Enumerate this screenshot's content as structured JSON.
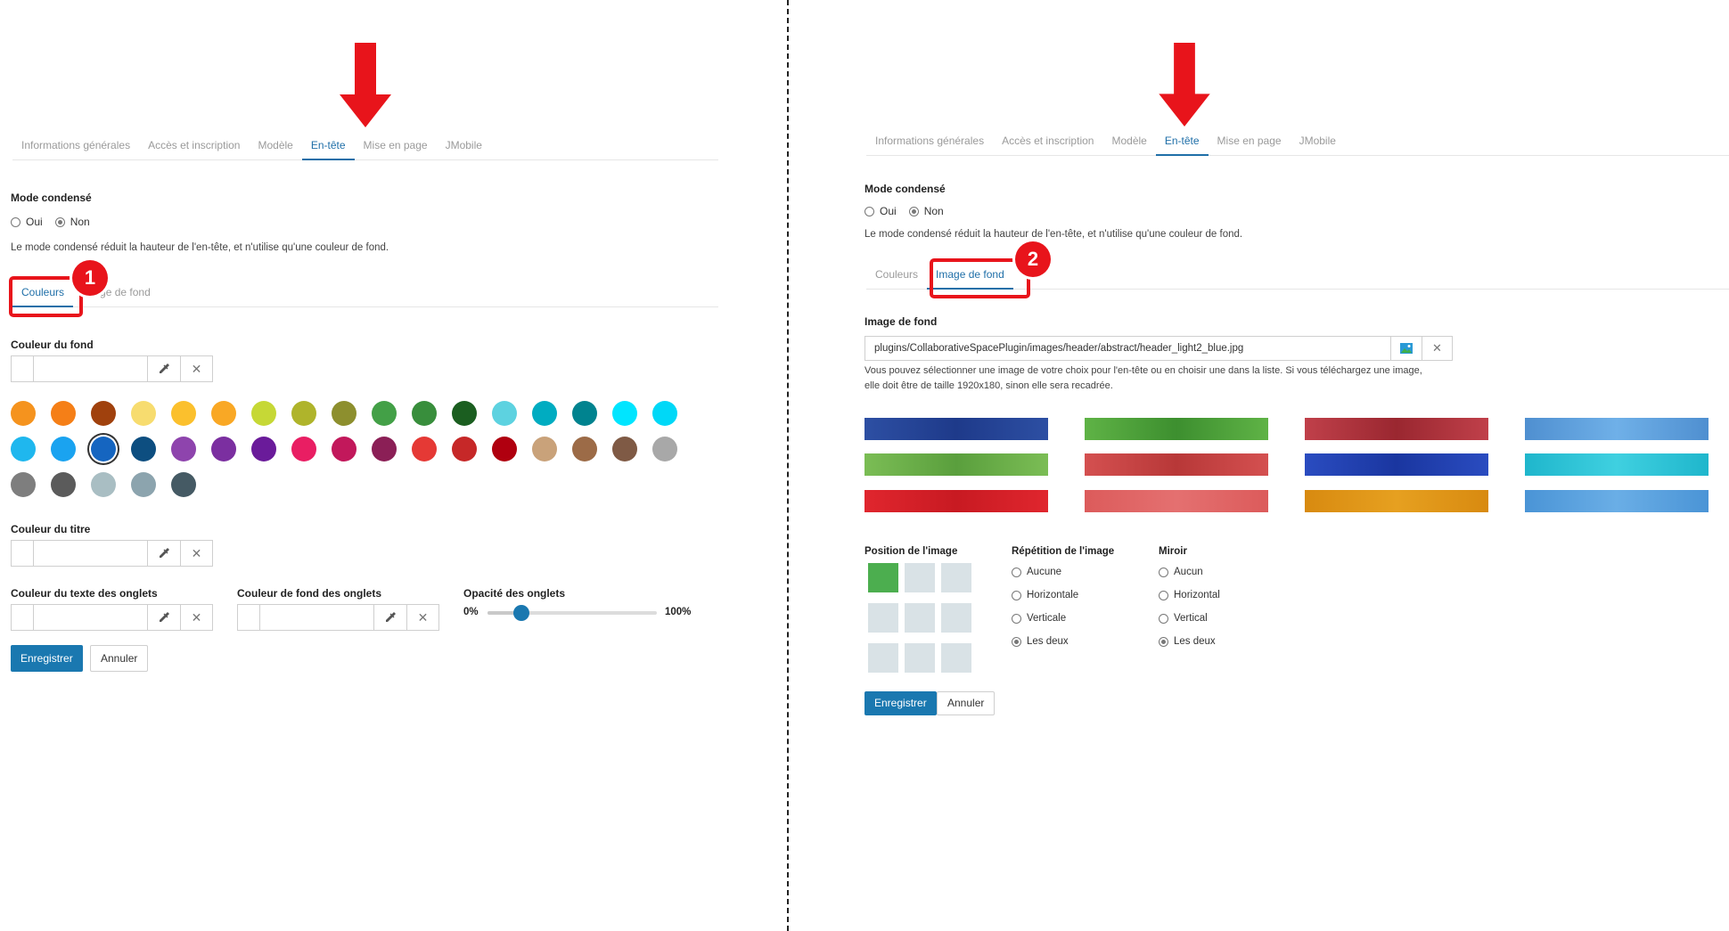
{
  "colors": {
    "accent": "#1a78b0",
    "arrow": "#e8141b",
    "callout": "#e8141b",
    "position_active": "#4cae4f",
    "position_inactive": "#d9e2e6"
  },
  "left": {
    "tabs": [
      {
        "label": "Informations générales",
        "active": false
      },
      {
        "label": "Accès et inscription",
        "active": false
      },
      {
        "label": "Modèle",
        "active": false
      },
      {
        "label": "En-tête",
        "active": true
      },
      {
        "label": "Mise en page",
        "active": false
      },
      {
        "label": "JMobile",
        "active": false
      }
    ],
    "mode_condense": {
      "title": "Mode condensé",
      "oui": "Oui",
      "non": "Non",
      "selected": "Non",
      "help": "Le mode condensé réduit la hauteur de l'en-tête, et n'utilise qu'une couleur de fond."
    },
    "subtabs": [
      {
        "label": "Couleurs",
        "active": true
      },
      {
        "label": "Image de fond",
        "active": false
      }
    ],
    "badge": "1",
    "couleur_fond": {
      "label": "Couleur du fond"
    },
    "palette": [
      "#f5931e",
      "#f57f17",
      "#a0410d",
      "#f7dc6f",
      "#fbc02d",
      "#f9a825",
      "#c6d836",
      "#afb42b",
      "#8d8f2e",
      "#43a047",
      "#388e3c",
      "#1b5e20",
      "#5dd2e0",
      "#00acc1",
      "#00838f",
      "#00e5ff",
      "#00d8f7",
      "#1fb7ee",
      "#1aa3f0",
      "#1565c0",
      "#0d4e80",
      "#8e44ad",
      "#7b2fa0",
      "#6a1b9a",
      "#e91e63",
      "#c2185b",
      "#8b1f56",
      "#e53935",
      "#c62828",
      "#b0000f",
      "#c9a27a",
      "#9c6b47",
      "#7f5a45",
      "#a8a8a8",
      "#7e7e7e",
      "#5b5b5b",
      "#a9bec3",
      "#8ca4ae",
      "#455a64"
    ],
    "palette_selected_index": 19,
    "couleur_titre": {
      "label": "Couleur du titre"
    },
    "couleur_texte_onglets": {
      "label": "Couleur du texte des onglets"
    },
    "couleur_fond_onglets": {
      "label": "Couleur de fond des onglets"
    },
    "opacite": {
      "label": "Opacité des onglets",
      "min_label": "0%",
      "max_label": "100%",
      "value": 0.2
    },
    "save": "Enregistrer",
    "cancel": "Annuler"
  },
  "right": {
    "tabs": [
      {
        "label": "Informations générales",
        "active": false
      },
      {
        "label": "Accès et inscription",
        "active": false
      },
      {
        "label": "Modèle",
        "active": false
      },
      {
        "label": "En-tête",
        "active": true
      },
      {
        "label": "Mise en page",
        "active": false
      },
      {
        "label": "JMobile",
        "active": false
      }
    ],
    "mode_condense": {
      "title": "Mode condensé",
      "oui": "Oui",
      "non": "Non",
      "selected": "Non",
      "help": "Le mode condensé réduit la hauteur de l'en-tête, et n'utilise qu'une couleur de fond."
    },
    "subtabs": [
      {
        "label": "Couleurs",
        "active": false
      },
      {
        "label": "Image de fond",
        "active": true
      }
    ],
    "badge": "2",
    "image_fond": {
      "label": "Image de fond",
      "path": "plugins/CollaborativeSpacePlugin/images/header/abstract/header_light2_blue.jpg",
      "help1": "Vous pouvez sélectionner une image de votre choix pour l'en-tête ou en choisir une dans la liste. Si vous téléchargez une image,",
      "help2": "elle doit être de taille 1920x180, sinon elle sera recadrée."
    },
    "banners": [
      {
        "from": "#2d4fa3",
        "to": "#1e3a8a"
      },
      {
        "from": "#5fb346",
        "to": "#3d8f2f"
      },
      {
        "from": "#c0404a",
        "to": "#9a2730"
      },
      {
        "from": "#4f8fd0",
        "to": "#6fb0e8"
      },
      {
        "from": "#7bbd55",
        "to": "#5a9f3d"
      },
      {
        "from": "#d45050",
        "to": "#b83838"
      },
      {
        "from": "#2a4cc0",
        "to": "#1a36a0"
      },
      {
        "from": "#1fb6cc",
        "to": "#3fd0e0"
      },
      {
        "from": "#e0262e",
        "to": "#c81a22"
      },
      {
        "from": "#dc5b5b",
        "to": "#e47070"
      },
      {
        "from": "#d88a10",
        "to": "#e6a020"
      },
      {
        "from": "#4a94d6",
        "to": "#6aaee6"
      }
    ],
    "position": {
      "label": "Position de l'image",
      "active_index": 0
    },
    "repetition": {
      "label": "Répétition de l'image",
      "options": [
        "Aucune",
        "Horizontale",
        "Verticale",
        "Les deux"
      ],
      "selected": "Les deux"
    },
    "miroir": {
      "label": "Miroir",
      "options": [
        "Aucun",
        "Horizontal",
        "Vertical",
        "Les deux"
      ],
      "selected": "Les deux"
    },
    "save": "Enregistrer",
    "cancel": "Annuler"
  }
}
